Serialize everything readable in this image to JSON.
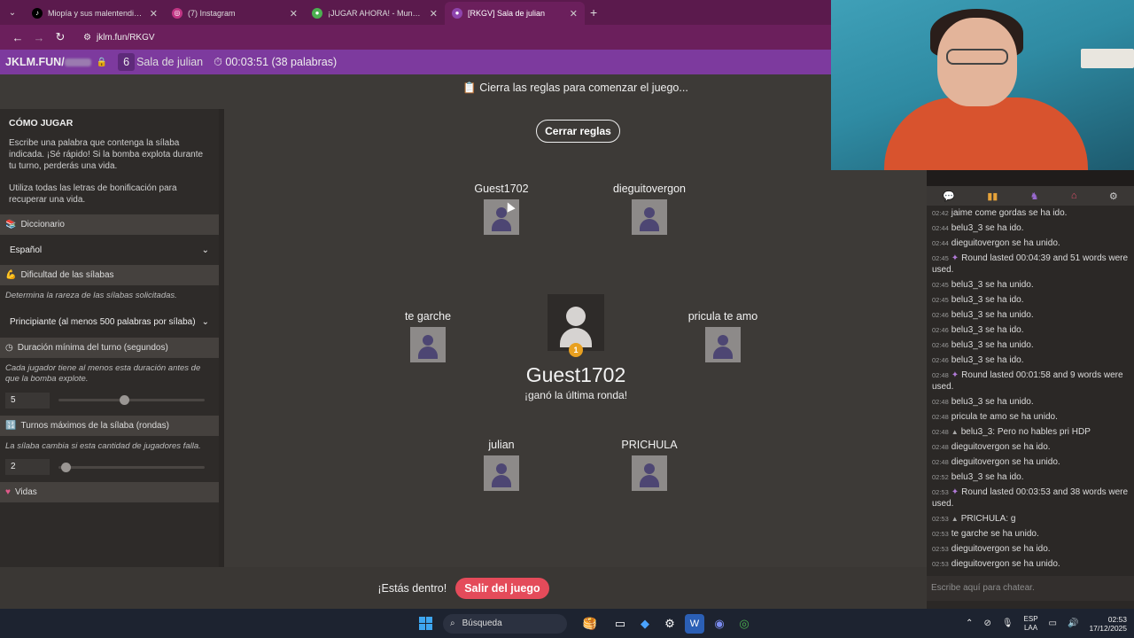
{
  "browser": {
    "tabs": [
      {
        "title": "Miopía y sus malentendidos: La",
        "icon": "tiktok-icon",
        "color": "#000000"
      },
      {
        "title": "(7) Instagram",
        "icon": "instagram-icon",
        "color": "#c13584"
      },
      {
        "title": "¡JUGAR AHORA! - Mundogatu",
        "icon": "game-icon",
        "color": "#4caf50"
      },
      {
        "title": "[RKGV] Sala de julian",
        "icon": "bomb-icon",
        "color": "#8e44ad"
      }
    ],
    "url": "jklm.fun/RKGV"
  },
  "gamebar": {
    "brand": "JKLM.FUN/",
    "player_count": "6",
    "room": "Sala de julian",
    "timer": "00:03:51 (38 palabras)"
  },
  "left_panel": {
    "title": "CÓMO JUGAR",
    "intro": "Escribe una palabra que contenga la sílaba indicada. ¡Sé rápido! Si la bomba explota durante tu turno, perderás una vida.",
    "bonus": "Utiliza todas las letras de bonificación para recuperar una vida.",
    "dictionary": {
      "header": "Diccionario",
      "value": "Español"
    },
    "difficulty": {
      "header": "Dificultad de las sílabas",
      "desc": "Determina la rareza de las sílabas solicitadas.",
      "value": "Principiante (al menos 500 palabras por sílaba)"
    },
    "min_turn": {
      "header": "Duración mínima del turno (segundos)",
      "desc": "Cada jugador tiene al menos esta duración antes de que la bomba explote.",
      "value": "5",
      "level": 0.45
    },
    "max_turns": {
      "header": "Turnos máximos de la sílaba (rondas)",
      "desc": "La sílaba cambia si esta cantidad de jugadores falla.",
      "value": "2",
      "level": 0.05
    },
    "lives": {
      "header": "Vidas"
    }
  },
  "game": {
    "notice": "Cierra las reglas para comenzar el juego...",
    "close_rules": "Cerrar reglas",
    "players": [
      "Guest1702",
      "dieguitovergon",
      "te garche",
      "pricula te amo",
      "julian",
      "PRICHULA"
    ],
    "winner": {
      "name": "Guest1702",
      "subtitle": "¡ganó la última ronda!",
      "medal": "1"
    }
  },
  "bottom": {
    "inside": "¡Estás dentro!",
    "leave": "Salir del juego"
  },
  "chat": {
    "messages": [
      {
        "time": "02:42",
        "text": "jaime come gordas se ha ido."
      },
      {
        "time": "02:44",
        "text": "belu3_3 se ha ido."
      },
      {
        "time": "02:44",
        "text": "dieguitovergon se ha unido."
      },
      {
        "time": "02:45",
        "text": "Round lasted 00:04:39 and 51 words were used.",
        "kind": "round"
      },
      {
        "time": "02:45",
        "text": "belu3_3 se ha unido."
      },
      {
        "time": "02:45",
        "text": "belu3_3 se ha ido."
      },
      {
        "time": "02:46",
        "text": "belu3_3 se ha unido."
      },
      {
        "time": "02:46",
        "text": "belu3_3 se ha ido."
      },
      {
        "time": "02:46",
        "text": "belu3_3 se ha unido."
      },
      {
        "time": "02:46",
        "text": "belu3_3 se ha ido."
      },
      {
        "time": "02:48",
        "text": "Round lasted 00:01:58 and 9 words were used.",
        "kind": "round"
      },
      {
        "time": "02:48",
        "text": "belu3_3 se ha unido."
      },
      {
        "time": "02:48",
        "text": "pricula te amo se ha unido."
      },
      {
        "time": "02:48",
        "text": "belu3_3: Pero no hables pri HDP",
        "kind": "user"
      },
      {
        "time": "02:48",
        "text": "dieguitovergon se ha ido."
      },
      {
        "time": "02:48",
        "text": "dieguitovergon se ha unido."
      },
      {
        "time": "02:52",
        "text": "belu3_3 se ha ido."
      },
      {
        "time": "02:53",
        "text": "Round lasted 00:03:53 and 38 words were used.",
        "kind": "round"
      },
      {
        "time": "02:53",
        "text": "PRICHULA: g",
        "kind": "user"
      },
      {
        "time": "02:53",
        "text": "te garche se ha unido."
      },
      {
        "time": "02:53",
        "text": "dieguitovergon se ha ido."
      },
      {
        "time": "02:53",
        "text": "dieguitovergon se ha unido."
      }
    ],
    "placeholder": "Escribe aquí para chatear."
  },
  "taskbar": {
    "search": "Búsqueda",
    "lang_top": "ESP",
    "lang_bottom": "LAA",
    "time": "02:53",
    "date": "17/12/2025"
  }
}
